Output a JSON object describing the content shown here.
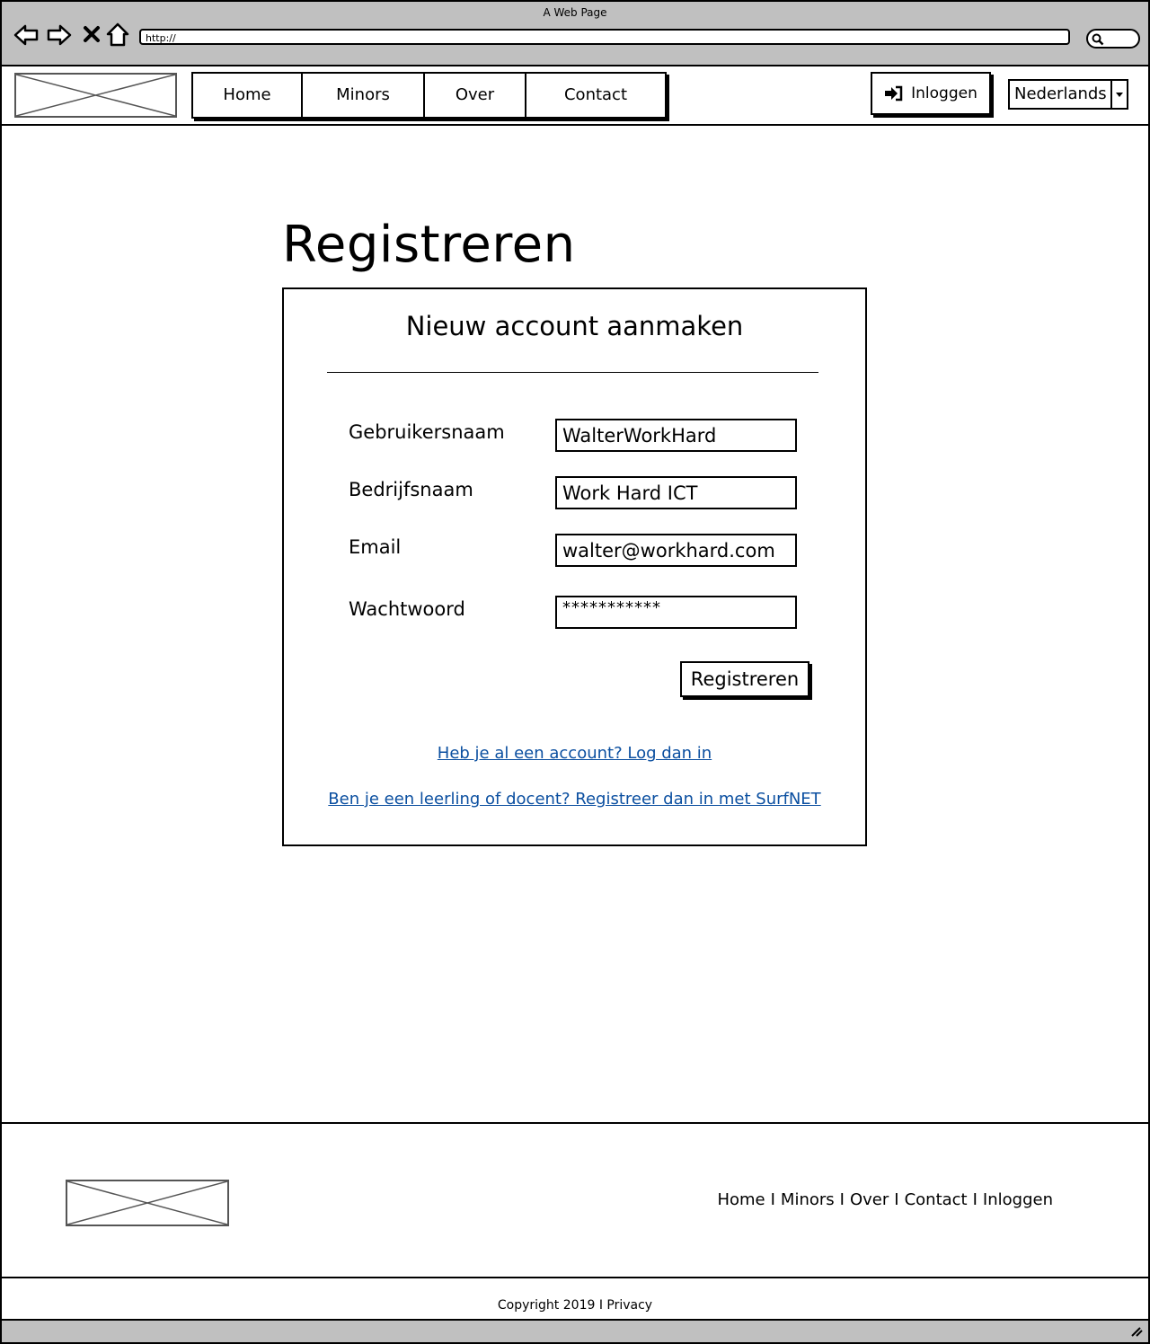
{
  "browser": {
    "window_title": "A Web Page",
    "url": "http://",
    "icons": [
      "back-icon",
      "forward-icon",
      "close-icon",
      "home-icon",
      "search-icon"
    ]
  },
  "header": {
    "nav": [
      "Home",
      "Minors",
      "Over",
      "Contact"
    ],
    "login_label": "Inloggen",
    "language": "Nederlands"
  },
  "main": {
    "page_title": "Registreren",
    "card_title": "Nieuw account aanmaken",
    "fields": {
      "username": {
        "label": "Gebruikersnaam",
        "value": "WalterWorkHard"
      },
      "company": {
        "label": "Bedrijfsnaam",
        "value": "Work Hard ICT"
      },
      "email": {
        "label": "Email",
        "value": "walter@workhard.com"
      },
      "password": {
        "label": "Wachtwoord",
        "value": "***********"
      }
    },
    "submit_label": "Registreren",
    "login_link": "Heb je al een account? Log dan in",
    "surfnet_link": "Ben je een leerling of docent? Registreer dan in met SurfNET"
  },
  "footer": {
    "links": [
      "Home",
      "Minors",
      "Over",
      "Contact",
      "Inloggen"
    ],
    "separator": "I",
    "copyright": "Copyright 2019 I Privacy"
  }
}
